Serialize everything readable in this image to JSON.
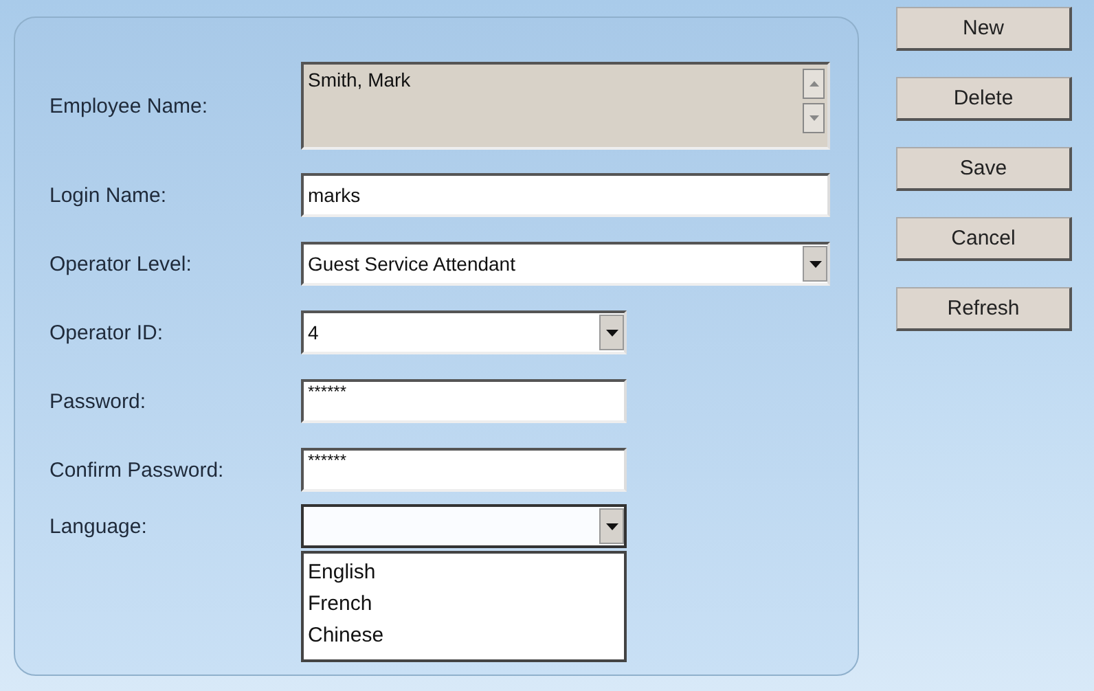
{
  "fields": [
    {
      "label": "Employee Name:",
      "kind": "multiline",
      "value": "Smith, Mark"
    },
    {
      "label": "Login Name:",
      "kind": "text",
      "value": "marks"
    },
    {
      "label": "Operator Level:",
      "kind": "combo",
      "value": "Guest Service Attendant"
    },
    {
      "label": "Operator ID:",
      "kind": "combo",
      "value": "4"
    },
    {
      "label": "Password:",
      "kind": "password",
      "value": "******"
    },
    {
      "label": "Confirm Password:",
      "kind": "password",
      "value": "******"
    },
    {
      "label": "Language:",
      "kind": "combo",
      "expanded": true,
      "options": [
        "English",
        "French",
        "Chinese"
      ]
    }
  ],
  "buttons": [
    "New",
    "Delete",
    "Save",
    "Cancel",
    "Refresh"
  ]
}
